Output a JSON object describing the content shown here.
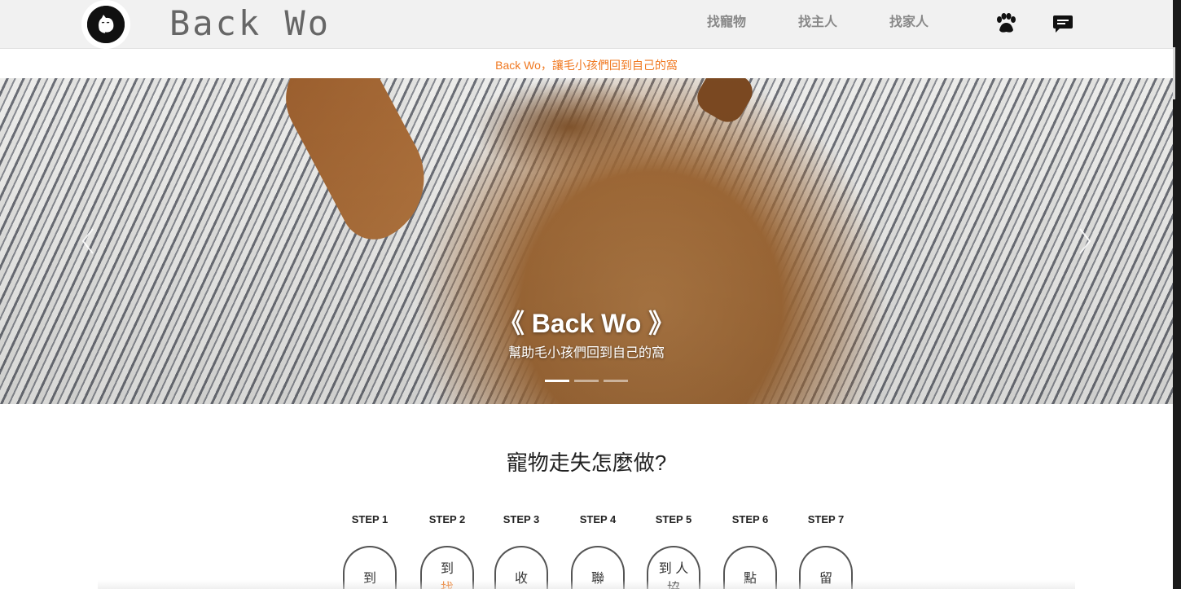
{
  "header": {
    "brand": "Back Wo",
    "nav": [
      "找寵物",
      "找主人",
      "找家人"
    ],
    "icons": [
      "paw-icon",
      "chat-icon"
    ]
  },
  "announcement": "Back Wo，讓毛小孩們回到自己的窩",
  "hero": {
    "title": "《 Back Wo 》",
    "subtitle": "幫助毛小孩們回到自己的窩",
    "slide_count": 3,
    "active_slide": 1
  },
  "steps_section": {
    "title": "寵物走失怎麼做?",
    "steps": [
      {
        "label": "STEP 1",
        "line1": "到",
        "line2": ""
      },
      {
        "label": "STEP 2",
        "line1": "到",
        "line2": "找"
      },
      {
        "label": "STEP 3",
        "line1": "收",
        "line2": ""
      },
      {
        "label": "STEP 4",
        "line1": "聯",
        "line2": ""
      },
      {
        "label": "STEP 5",
        "line1": "到 人",
        "line2": "協"
      },
      {
        "label": "STEP 6",
        "line1": "點",
        "line2": ""
      },
      {
        "label": "STEP 7",
        "line1": "留",
        "line2": ""
      }
    ]
  },
  "colors": {
    "accent": "#f07820",
    "header_bg": "#f1f1f1",
    "nav_text": "#888888"
  }
}
